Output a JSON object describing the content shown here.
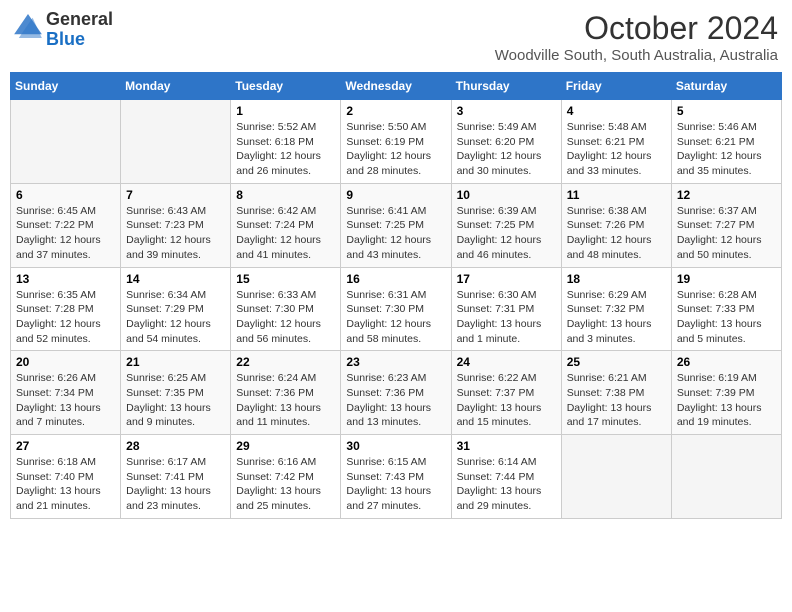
{
  "header": {
    "logo_line1": "General",
    "logo_line2": "Blue",
    "month": "October 2024",
    "location": "Woodville South, South Australia, Australia"
  },
  "days_of_week": [
    "Sunday",
    "Monday",
    "Tuesday",
    "Wednesday",
    "Thursday",
    "Friday",
    "Saturday"
  ],
  "weeks": [
    [
      {
        "day": "",
        "info": ""
      },
      {
        "day": "",
        "info": ""
      },
      {
        "day": "1",
        "info": "Sunrise: 5:52 AM\nSunset: 6:18 PM\nDaylight: 12 hours\nand 26 minutes."
      },
      {
        "day": "2",
        "info": "Sunrise: 5:50 AM\nSunset: 6:19 PM\nDaylight: 12 hours\nand 28 minutes."
      },
      {
        "day": "3",
        "info": "Sunrise: 5:49 AM\nSunset: 6:20 PM\nDaylight: 12 hours\nand 30 minutes."
      },
      {
        "day": "4",
        "info": "Sunrise: 5:48 AM\nSunset: 6:21 PM\nDaylight: 12 hours\nand 33 minutes."
      },
      {
        "day": "5",
        "info": "Sunrise: 5:46 AM\nSunset: 6:21 PM\nDaylight: 12 hours\nand 35 minutes."
      }
    ],
    [
      {
        "day": "6",
        "info": "Sunrise: 6:45 AM\nSunset: 7:22 PM\nDaylight: 12 hours\nand 37 minutes."
      },
      {
        "day": "7",
        "info": "Sunrise: 6:43 AM\nSunset: 7:23 PM\nDaylight: 12 hours\nand 39 minutes."
      },
      {
        "day": "8",
        "info": "Sunrise: 6:42 AM\nSunset: 7:24 PM\nDaylight: 12 hours\nand 41 minutes."
      },
      {
        "day": "9",
        "info": "Sunrise: 6:41 AM\nSunset: 7:25 PM\nDaylight: 12 hours\nand 43 minutes."
      },
      {
        "day": "10",
        "info": "Sunrise: 6:39 AM\nSunset: 7:25 PM\nDaylight: 12 hours\nand 46 minutes."
      },
      {
        "day": "11",
        "info": "Sunrise: 6:38 AM\nSunset: 7:26 PM\nDaylight: 12 hours\nand 48 minutes."
      },
      {
        "day": "12",
        "info": "Sunrise: 6:37 AM\nSunset: 7:27 PM\nDaylight: 12 hours\nand 50 minutes."
      }
    ],
    [
      {
        "day": "13",
        "info": "Sunrise: 6:35 AM\nSunset: 7:28 PM\nDaylight: 12 hours\nand 52 minutes."
      },
      {
        "day": "14",
        "info": "Sunrise: 6:34 AM\nSunset: 7:29 PM\nDaylight: 12 hours\nand 54 minutes."
      },
      {
        "day": "15",
        "info": "Sunrise: 6:33 AM\nSunset: 7:30 PM\nDaylight: 12 hours\nand 56 minutes."
      },
      {
        "day": "16",
        "info": "Sunrise: 6:31 AM\nSunset: 7:30 PM\nDaylight: 12 hours\nand 58 minutes."
      },
      {
        "day": "17",
        "info": "Sunrise: 6:30 AM\nSunset: 7:31 PM\nDaylight: 13 hours\nand 1 minute."
      },
      {
        "day": "18",
        "info": "Sunrise: 6:29 AM\nSunset: 7:32 PM\nDaylight: 13 hours\nand 3 minutes."
      },
      {
        "day": "19",
        "info": "Sunrise: 6:28 AM\nSunset: 7:33 PM\nDaylight: 13 hours\nand 5 minutes."
      }
    ],
    [
      {
        "day": "20",
        "info": "Sunrise: 6:26 AM\nSunset: 7:34 PM\nDaylight: 13 hours\nand 7 minutes."
      },
      {
        "day": "21",
        "info": "Sunrise: 6:25 AM\nSunset: 7:35 PM\nDaylight: 13 hours\nand 9 minutes."
      },
      {
        "day": "22",
        "info": "Sunrise: 6:24 AM\nSunset: 7:36 PM\nDaylight: 13 hours\nand 11 minutes."
      },
      {
        "day": "23",
        "info": "Sunrise: 6:23 AM\nSunset: 7:36 PM\nDaylight: 13 hours\nand 13 minutes."
      },
      {
        "day": "24",
        "info": "Sunrise: 6:22 AM\nSunset: 7:37 PM\nDaylight: 13 hours\nand 15 minutes."
      },
      {
        "day": "25",
        "info": "Sunrise: 6:21 AM\nSunset: 7:38 PM\nDaylight: 13 hours\nand 17 minutes."
      },
      {
        "day": "26",
        "info": "Sunrise: 6:19 AM\nSunset: 7:39 PM\nDaylight: 13 hours\nand 19 minutes."
      }
    ],
    [
      {
        "day": "27",
        "info": "Sunrise: 6:18 AM\nSunset: 7:40 PM\nDaylight: 13 hours\nand 21 minutes."
      },
      {
        "day": "28",
        "info": "Sunrise: 6:17 AM\nSunset: 7:41 PM\nDaylight: 13 hours\nand 23 minutes."
      },
      {
        "day": "29",
        "info": "Sunrise: 6:16 AM\nSunset: 7:42 PM\nDaylight: 13 hours\nand 25 minutes."
      },
      {
        "day": "30",
        "info": "Sunrise: 6:15 AM\nSunset: 7:43 PM\nDaylight: 13 hours\nand 27 minutes."
      },
      {
        "day": "31",
        "info": "Sunrise: 6:14 AM\nSunset: 7:44 PM\nDaylight: 13 hours\nand 29 minutes."
      },
      {
        "day": "",
        "info": ""
      },
      {
        "day": "",
        "info": ""
      }
    ]
  ]
}
